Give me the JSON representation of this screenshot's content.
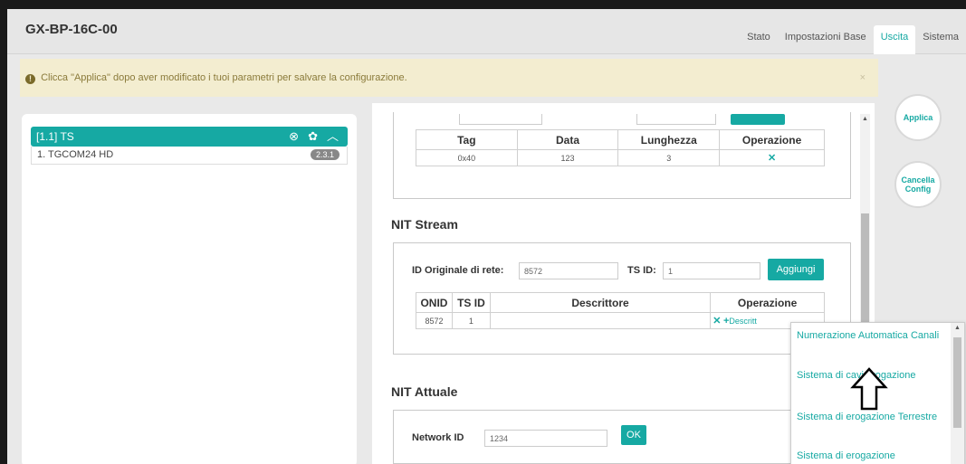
{
  "app": {
    "title": "GX-BP-16C-00"
  },
  "nav": {
    "tabs": [
      {
        "label": "Stato"
      },
      {
        "label": "Impostazioni Base"
      },
      {
        "label": "Uscita",
        "active": true
      },
      {
        "label": "Sistema"
      }
    ]
  },
  "alert": {
    "text": "Clicca \"Applica\" dopo aver modificato i tuoi parametri per salvare la configurazione.",
    "close": "×"
  },
  "left_panel": {
    "ts_header": "[1.1] TS",
    "channels": [
      {
        "name": "1. TGCOM24 HD",
        "badge": "2.3.1"
      }
    ]
  },
  "descriptor_table": {
    "headers": [
      "Tag",
      "Data",
      "Lunghezza",
      "Operazione"
    ],
    "rows": [
      {
        "tag": "0x40",
        "data": "123",
        "length": "3"
      }
    ]
  },
  "nit_stream": {
    "title": "NIT Stream",
    "onid_label": "ID Originale di rete:",
    "onid_value": "8572",
    "tsid_label": "TS ID:",
    "tsid_value": "1",
    "add_button": "Aggiungi",
    "headers": [
      "ONID",
      "TS ID",
      "Descrittore",
      "Operazione"
    ],
    "rows": [
      {
        "onid": "8572",
        "tsid": "1",
        "descriptor": "",
        "op_desc": "Descritt"
      }
    ]
  },
  "nit_attuale": {
    "title": "NIT Attuale",
    "network_label": "Network ID",
    "network_value": "1234",
    "ok_button": "OK"
  },
  "side_buttons": {
    "apply": "Applica",
    "reset_line1": "Cancella",
    "reset_line2": "Config"
  },
  "dropdown": {
    "items": [
      "Numerazione Automatica Canali",
      "Sistema di cavi erogazione",
      "Sistema di erogazione Terrestre",
      "Sistema di erogazione"
    ]
  },
  "colors": {
    "accent": "#16a9a3",
    "alert_bg": "#f3edd0"
  }
}
